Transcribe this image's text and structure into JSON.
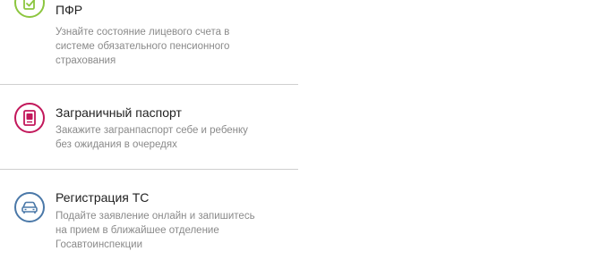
{
  "services": [
    {
      "title": "ПФР",
      "description": [
        "Узнайте состояние лицевого счета в",
        "системе обязательного пенсионного",
        "страхования"
      ],
      "icon": "document-check-icon",
      "color": "#8cc63f"
    },
    {
      "title": "Заграничный паспорт",
      "description": [
        "Закажите загранпаспорт себе и ребенку",
        "без ожидания в очередях"
      ],
      "icon": "passport-icon",
      "color": "#c2185b"
    },
    {
      "title": "Регистрация ТС",
      "description": [
        "Подайте заявление онлайн и запишитесь",
        "на прием в ближайшее отделение",
        "Госавтоинспекции"
      ],
      "icon": "car-icon",
      "color": "#4a78a8"
    }
  ]
}
